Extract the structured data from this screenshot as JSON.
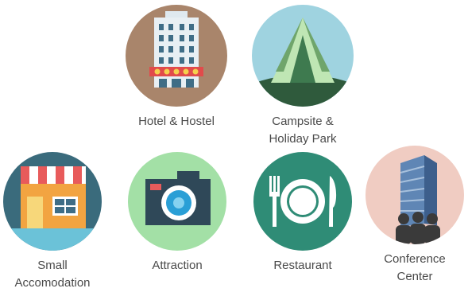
{
  "categories": [
    {
      "key": "hotel",
      "label": "Hotel & Hostel",
      "icon": "hotel-building-icon",
      "bg": "#a9856b"
    },
    {
      "key": "campsite",
      "label": "Campsite &\nHoliday Park",
      "icon": "tent-icon",
      "bg": "#9fd3e0"
    },
    {
      "key": "small",
      "label": "Small\nAccomodation",
      "icon": "shop-icon",
      "bg": "#3a6b7c"
    },
    {
      "key": "attraction",
      "label": "Attraction",
      "icon": "camera-icon",
      "bg": "#a3e0a6"
    },
    {
      "key": "restaurant",
      "label": "Restaurant",
      "icon": "plate-cutlery-icon",
      "bg": "#2f8c76"
    },
    {
      "key": "conference",
      "label": "Conference\nCenter",
      "icon": "office-tower-icon",
      "bg": "#f0ccc2"
    }
  ]
}
